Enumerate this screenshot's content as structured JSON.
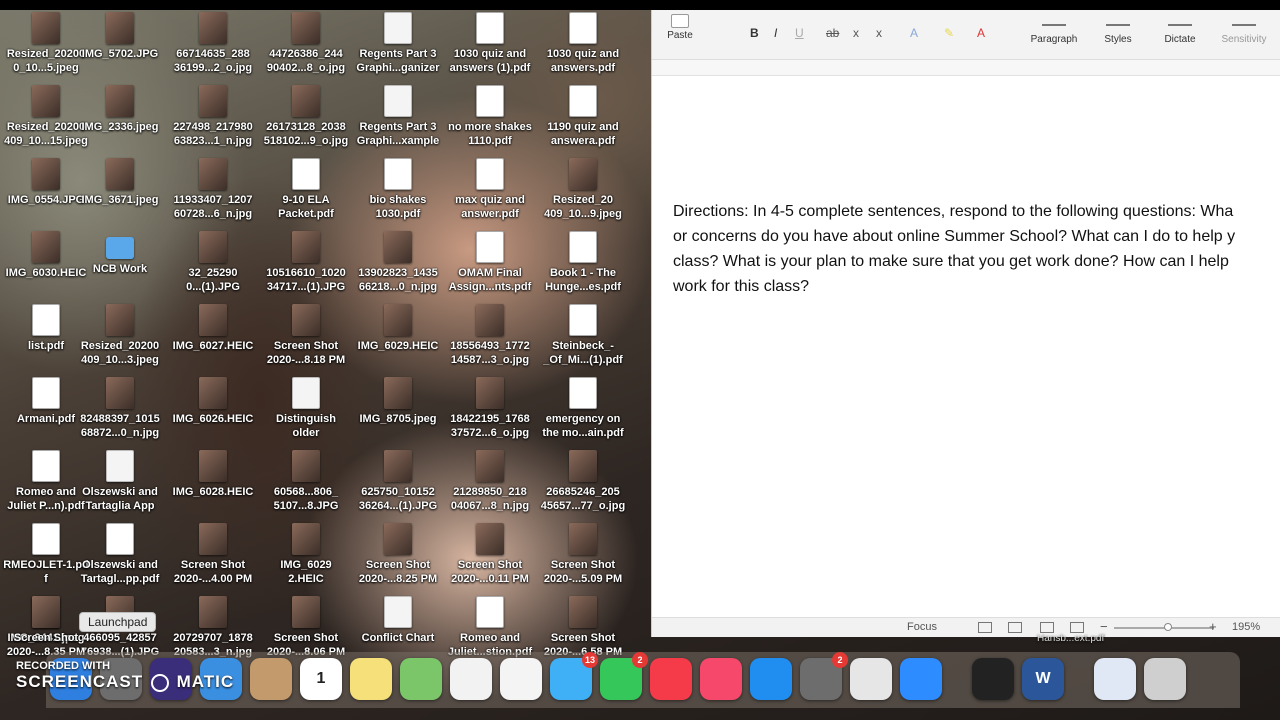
{
  "desktop_icons": [
    {
      "label": "Resized_20200\n0_10...5.jpeg",
      "type": "img"
    },
    {
      "label": "IMG_5702.JPG",
      "type": "img"
    },
    {
      "label": "66714635_288\n36199...2_o.jpg",
      "type": "img"
    },
    {
      "label": "44726386_244\n90402...8_o.jpg",
      "type": "img"
    },
    {
      "label": "Regents Part 3\nGraphi...ganizer",
      "type": "doc"
    },
    {
      "label": "1030 quiz and\nanswers (1).pdf",
      "type": "pdf"
    },
    {
      "label": "1030 quiz and\nanswers.pdf",
      "type": "pdf"
    },
    {
      "label": "Resized_20200\n409_10...15.jpeg",
      "type": "img"
    },
    {
      "label": "IMG_2336.jpeg",
      "type": "img"
    },
    {
      "label": "227498_217980\n63823...1_n.jpg",
      "type": "img"
    },
    {
      "label": "26173128_2038\n518102...9_o.jpg",
      "type": "img"
    },
    {
      "label": "Regents Part 3\nGraphi...xample",
      "type": "doc"
    },
    {
      "label": "no more shakes\n1110.pdf",
      "type": "pdf"
    },
    {
      "label": "1190 quiz and\nanswera.pdf",
      "type": "pdf"
    },
    {
      "label": "IMG_0554.JPG",
      "type": "img"
    },
    {
      "label": "IMG_3671.jpeg",
      "type": "img"
    },
    {
      "label": "11933407_1207\n60728...6_n.jpg",
      "type": "img"
    },
    {
      "label": "9-10 ELA\nPacket.pdf",
      "type": "pdf"
    },
    {
      "label": "bio shakes\n1030.pdf",
      "type": "pdf"
    },
    {
      "label": "max quiz and\nanswer.pdf",
      "type": "pdf"
    },
    {
      "label": "Resized_20\n409_10...9.jpeg",
      "type": "img"
    },
    {
      "label": "IMG_6030.HEIC",
      "type": "img"
    },
    {
      "label": "NCB Work",
      "type": "folder"
    },
    {
      "label": "32_25290\n0...(1).JPG",
      "type": "img"
    },
    {
      "label": "10516610_1020\n34717...(1).JPG",
      "type": "img"
    },
    {
      "label": "13902823_1435\n66218...0_n.jpg",
      "type": "img"
    },
    {
      "label": "OMAM Final\nAssign...nts.pdf",
      "type": "pdf"
    },
    {
      "label": "Book 1 - The\nHunge...es.pdf",
      "type": "pdf"
    },
    {
      "label": "list.pdf",
      "type": "pdf"
    },
    {
      "label": "Resized_20200\n409_10...3.jpeg",
      "type": "img"
    },
    {
      "label": "IMG_6027.HEIC",
      "type": "img"
    },
    {
      "label": "Screen Shot\n2020-...8.18 PM",
      "type": "img"
    },
    {
      "label": "IMG_6029.HEIC",
      "type": "img"
    },
    {
      "label": "18556493_1772\n14587...3_o.jpg",
      "type": "img"
    },
    {
      "label": "Steinbeck_-\n_Of_Mi...(1).pdf",
      "type": "pdf"
    },
    {
      "label": "Armani.pdf",
      "type": "pdf"
    },
    {
      "label": "82488397_1015\n68872...0_n.jpg",
      "type": "img"
    },
    {
      "label": "IMG_6026.HEIC",
      "type": "img"
    },
    {
      "label": "Distinguish\nolder",
      "type": "doc"
    },
    {
      "label": "IMG_8705.jpeg",
      "type": "img"
    },
    {
      "label": "18422195_1768\n37572...6_o.jpg",
      "type": "img"
    },
    {
      "label": "emergency on\nthe mo...ain.pdf",
      "type": "pdf"
    },
    {
      "label": "Romeo and\nJuliet P...n).pdf",
      "type": "pdf"
    },
    {
      "label": "Olszewski and\nTartaglia App",
      "type": "doc"
    },
    {
      "label": "IMG_6028.HEIC",
      "type": "img"
    },
    {
      "label": "60568...806_\n5107...8.JPG",
      "type": "img"
    },
    {
      "label": "625750_10152\n36264...(1).JPG",
      "type": "img"
    },
    {
      "label": "21289850_218\n04067...8_n.jpg",
      "type": "img"
    },
    {
      "label": "26685246_205\n45657...77_o.jpg",
      "type": "img"
    },
    {
      "label": "RMEOJLET-1.pd\nf",
      "type": "pdf"
    },
    {
      "label": "Olszewski and\nTartagl...pp.pdf",
      "type": "pdf"
    },
    {
      "label": "Screen Shot\n2020-...4.00 PM",
      "type": "img"
    },
    {
      "label": "IMG_6029\n2.HEIC",
      "type": "img"
    },
    {
      "label": "Screen Shot\n2020-...8.25 PM",
      "type": "img"
    },
    {
      "label": "Screen Shot\n2020-...0.11 PM",
      "type": "img"
    },
    {
      "label": "Screen Shot\n2020-...5.09 PM",
      "type": "img"
    },
    {
      "label": "IMG_3441.jpeg",
      "type": "img"
    },
    {
      "label": "466095_42857\n76938...(1).JPG",
      "type": "img"
    },
    {
      "label": "20729707_1878\n20583...3_n.jpg",
      "type": "img"
    },
    {
      "label": "Screen Shot\n2020-...8.06 PM",
      "type": "img"
    },
    {
      "label": "Conflict Chart",
      "type": "doc"
    },
    {
      "label": "Romeo and\nJuliet...stion.pdf",
      "type": "pdf"
    },
    {
      "label": "Screen Shot\n2020-...6.58 PM",
      "type": "img"
    },
    {
      "label": "Screen Shot\n2020-...8.35 PM",
      "type": "img"
    }
  ],
  "tooltip": "Launchpad",
  "ribbon": {
    "paste": "Paste",
    "bold": "B",
    "italic": "I",
    "underline": "U",
    "strike": "ab",
    "subscript": "x",
    "superscript": "x",
    "font_color": "A",
    "paragraph": "Paragraph",
    "styles": "Styles",
    "dictate": "Dictate",
    "sensitivity": "Sensitivity"
  },
  "document": {
    "text": "Directions: In 4-5 complete sentences, respond to the following questions: Wha\nor concerns do you have about online Summer School? What can I do to help y\nclass? What is your plan to make sure that you get work done? How can I help \nwork for this class?"
  },
  "statusbar": {
    "focus": "Focus",
    "zoom": "195%",
    "minus": "−",
    "plus": "+"
  },
  "dock": {
    "file_label": "Hansb...ext.pdf",
    "apps": [
      {
        "name": "finder",
        "label": "",
        "color": "#2f7fe0"
      },
      {
        "name": "launchpad",
        "label": "",
        "color": "#6d6d6d"
      },
      {
        "name": "siri",
        "label": "",
        "color": "#3a2d7a"
      },
      {
        "name": "mail",
        "label": "",
        "color": "#3b8fe0"
      },
      {
        "name": "contacts",
        "label": "",
        "color": "#c29a6b"
      },
      {
        "name": "calendar",
        "label": "1",
        "color": "#ffffff"
      },
      {
        "name": "notes",
        "label": "",
        "color": "#f5e07a"
      },
      {
        "name": "maps",
        "label": "",
        "color": "#7cc66a"
      },
      {
        "name": "reminders",
        "label": "",
        "color": "#f2f2f2"
      },
      {
        "name": "photos",
        "label": "",
        "color": "#f4f4f4"
      },
      {
        "name": "messages",
        "label": "",
        "color": "#3fb0f5",
        "badge": "13"
      },
      {
        "name": "facetime",
        "label": "",
        "color": "#35c759",
        "badge": "2"
      },
      {
        "name": "news",
        "label": "",
        "color": "#f53b4a"
      },
      {
        "name": "music",
        "label": "",
        "color": "#f5486a"
      },
      {
        "name": "app-store",
        "label": "",
        "color": "#1f8ef0"
      },
      {
        "name": "system-preferences",
        "label": "",
        "color": "#6d6d6d",
        "badge": "2"
      },
      {
        "name": "chrome",
        "label": "",
        "color": "#e6e6e6"
      },
      {
        "name": "zoom",
        "label": "",
        "color": "#2d8cff"
      },
      {
        "name": "screenshot",
        "label": "",
        "color": "#222222"
      },
      {
        "name": "word",
        "label": "W",
        "color": "#2b579a"
      },
      {
        "name": "preview",
        "label": "",
        "color": "#dfe8f4"
      },
      {
        "name": "trash",
        "label": "",
        "color": "#cfcfcf"
      }
    ]
  },
  "watermark": {
    "line1": "RECORDED WITH",
    "line2": "SCREENCAST",
    "line3": "MATIC"
  }
}
